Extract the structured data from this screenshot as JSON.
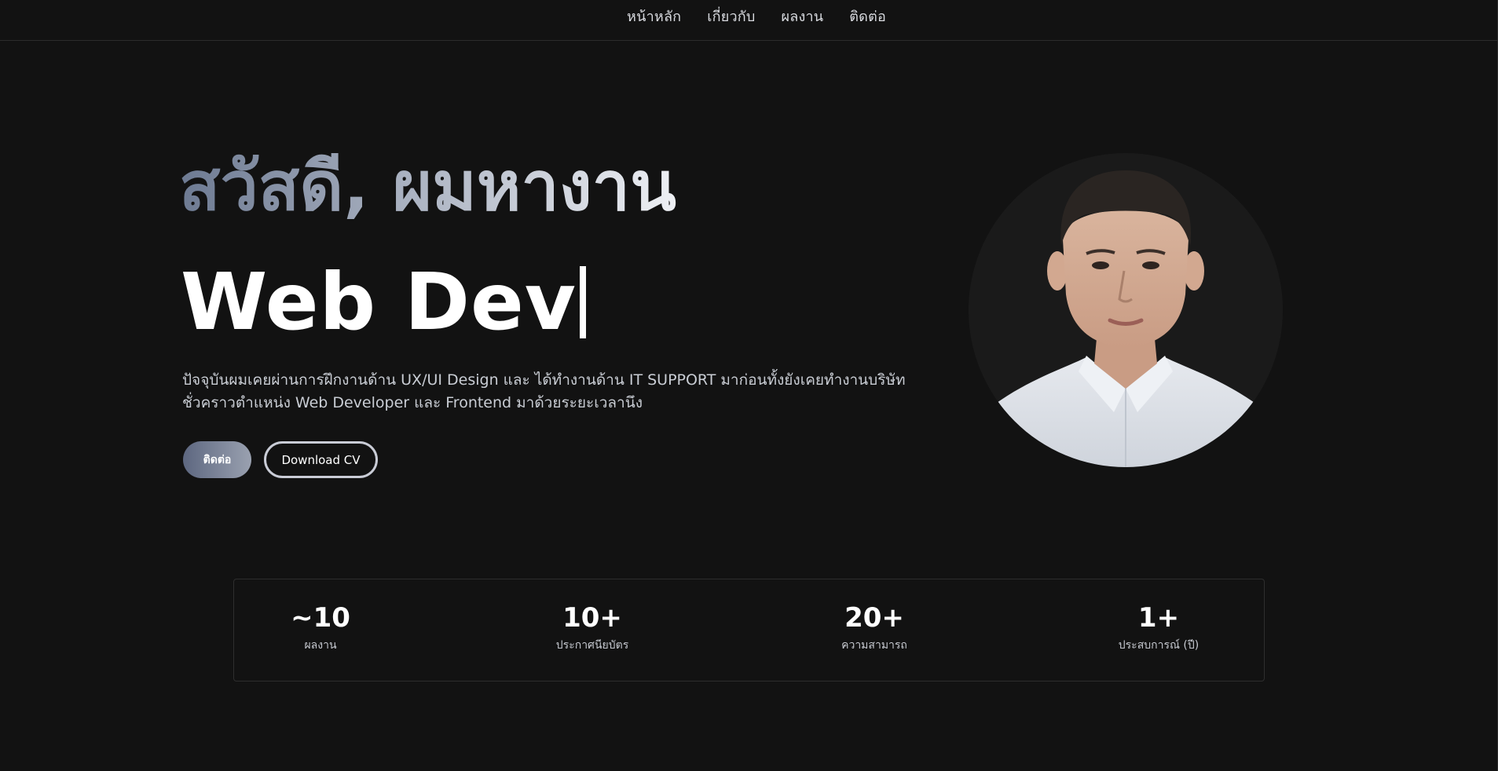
{
  "nav": {
    "items": [
      {
        "label": "หน้าหลัก"
      },
      {
        "label": "เกี่ยวกับ"
      },
      {
        "label": "ผลงาน"
      },
      {
        "label": "ติดต่อ"
      }
    ]
  },
  "hero": {
    "title": "สวัสดี, ผมหางาน",
    "typed_text": "Web Dev",
    "description": "ปัจจุบันผมเคยผ่านการฝึกงานด้าน UX/UI Design และ ได้ทำงานด้าน IT SUPPORT มาก่อนทั้งยังเคยทำงานบริษัท ชั่วคราวตำแหน่ง Web Developer และ Frontend มาด้วยระยะเวลานึง",
    "buttons": {
      "contact_label": "ติดต่อ",
      "cv_label": "Download CV"
    }
  },
  "stats": [
    {
      "value": "~10",
      "label": "ผลงาน"
    },
    {
      "value": "10+",
      "label": "ประกาศนียบัตร"
    },
    {
      "value": "20+",
      "label": "ความสามารถ"
    },
    {
      "value": "1+",
      "label": "ประสบการณ์ (ปี)"
    }
  ],
  "colors": {
    "background": "#121212",
    "gradient_start": "#6d7a92",
    "gradient_end": "#eef0f4",
    "text_primary": "#ffffff",
    "text_secondary": "#c9cdd4"
  }
}
